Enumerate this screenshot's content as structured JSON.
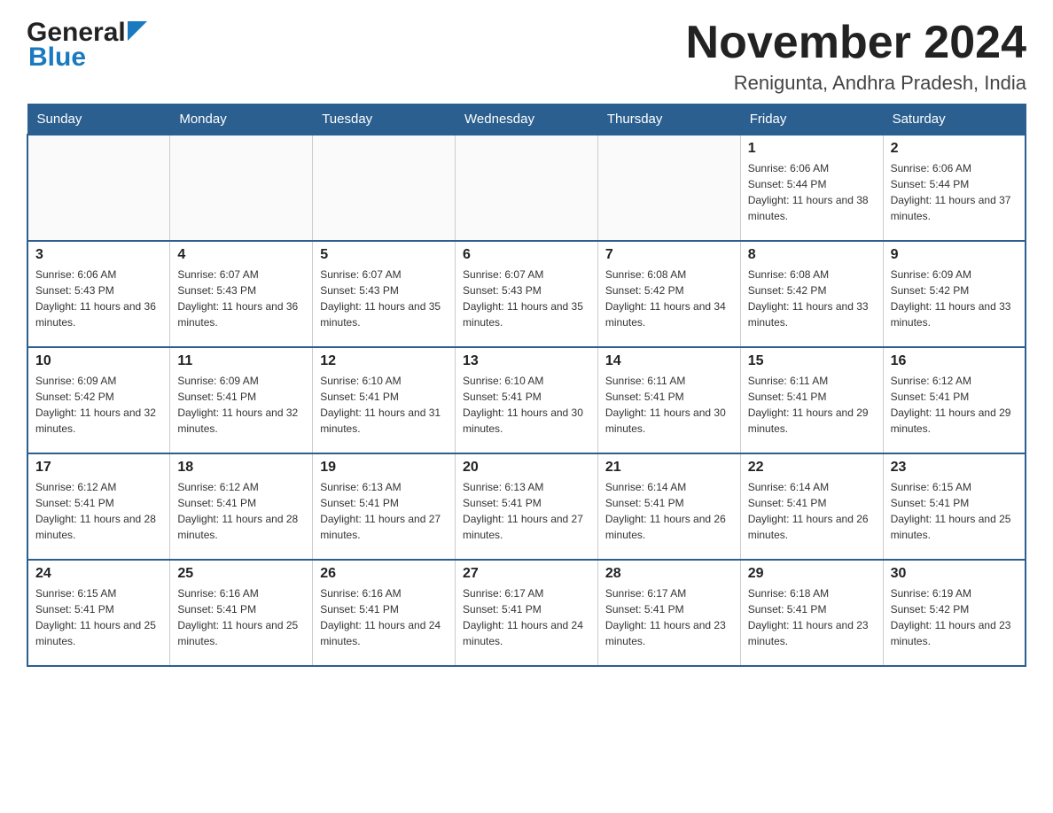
{
  "header": {
    "logo_general": "General",
    "logo_blue": "Blue",
    "month_title": "November 2024",
    "location": "Renigunta, Andhra Pradesh, India"
  },
  "days_of_week": [
    "Sunday",
    "Monday",
    "Tuesday",
    "Wednesday",
    "Thursday",
    "Friday",
    "Saturday"
  ],
  "weeks": [
    [
      {
        "day": "",
        "info": ""
      },
      {
        "day": "",
        "info": ""
      },
      {
        "day": "",
        "info": ""
      },
      {
        "day": "",
        "info": ""
      },
      {
        "day": "",
        "info": ""
      },
      {
        "day": "1",
        "info": "Sunrise: 6:06 AM\nSunset: 5:44 PM\nDaylight: 11 hours and 38 minutes."
      },
      {
        "day": "2",
        "info": "Sunrise: 6:06 AM\nSunset: 5:44 PM\nDaylight: 11 hours and 37 minutes."
      }
    ],
    [
      {
        "day": "3",
        "info": "Sunrise: 6:06 AM\nSunset: 5:43 PM\nDaylight: 11 hours and 36 minutes."
      },
      {
        "day": "4",
        "info": "Sunrise: 6:07 AM\nSunset: 5:43 PM\nDaylight: 11 hours and 36 minutes."
      },
      {
        "day": "5",
        "info": "Sunrise: 6:07 AM\nSunset: 5:43 PM\nDaylight: 11 hours and 35 minutes."
      },
      {
        "day": "6",
        "info": "Sunrise: 6:07 AM\nSunset: 5:43 PM\nDaylight: 11 hours and 35 minutes."
      },
      {
        "day": "7",
        "info": "Sunrise: 6:08 AM\nSunset: 5:42 PM\nDaylight: 11 hours and 34 minutes."
      },
      {
        "day": "8",
        "info": "Sunrise: 6:08 AM\nSunset: 5:42 PM\nDaylight: 11 hours and 33 minutes."
      },
      {
        "day": "9",
        "info": "Sunrise: 6:09 AM\nSunset: 5:42 PM\nDaylight: 11 hours and 33 minutes."
      }
    ],
    [
      {
        "day": "10",
        "info": "Sunrise: 6:09 AM\nSunset: 5:42 PM\nDaylight: 11 hours and 32 minutes."
      },
      {
        "day": "11",
        "info": "Sunrise: 6:09 AM\nSunset: 5:41 PM\nDaylight: 11 hours and 32 minutes."
      },
      {
        "day": "12",
        "info": "Sunrise: 6:10 AM\nSunset: 5:41 PM\nDaylight: 11 hours and 31 minutes."
      },
      {
        "day": "13",
        "info": "Sunrise: 6:10 AM\nSunset: 5:41 PM\nDaylight: 11 hours and 30 minutes."
      },
      {
        "day": "14",
        "info": "Sunrise: 6:11 AM\nSunset: 5:41 PM\nDaylight: 11 hours and 30 minutes."
      },
      {
        "day": "15",
        "info": "Sunrise: 6:11 AM\nSunset: 5:41 PM\nDaylight: 11 hours and 29 minutes."
      },
      {
        "day": "16",
        "info": "Sunrise: 6:12 AM\nSunset: 5:41 PM\nDaylight: 11 hours and 29 minutes."
      }
    ],
    [
      {
        "day": "17",
        "info": "Sunrise: 6:12 AM\nSunset: 5:41 PM\nDaylight: 11 hours and 28 minutes."
      },
      {
        "day": "18",
        "info": "Sunrise: 6:12 AM\nSunset: 5:41 PM\nDaylight: 11 hours and 28 minutes."
      },
      {
        "day": "19",
        "info": "Sunrise: 6:13 AM\nSunset: 5:41 PM\nDaylight: 11 hours and 27 minutes."
      },
      {
        "day": "20",
        "info": "Sunrise: 6:13 AM\nSunset: 5:41 PM\nDaylight: 11 hours and 27 minutes."
      },
      {
        "day": "21",
        "info": "Sunrise: 6:14 AM\nSunset: 5:41 PM\nDaylight: 11 hours and 26 minutes."
      },
      {
        "day": "22",
        "info": "Sunrise: 6:14 AM\nSunset: 5:41 PM\nDaylight: 11 hours and 26 minutes."
      },
      {
        "day": "23",
        "info": "Sunrise: 6:15 AM\nSunset: 5:41 PM\nDaylight: 11 hours and 25 minutes."
      }
    ],
    [
      {
        "day": "24",
        "info": "Sunrise: 6:15 AM\nSunset: 5:41 PM\nDaylight: 11 hours and 25 minutes."
      },
      {
        "day": "25",
        "info": "Sunrise: 6:16 AM\nSunset: 5:41 PM\nDaylight: 11 hours and 25 minutes."
      },
      {
        "day": "26",
        "info": "Sunrise: 6:16 AM\nSunset: 5:41 PM\nDaylight: 11 hours and 24 minutes."
      },
      {
        "day": "27",
        "info": "Sunrise: 6:17 AM\nSunset: 5:41 PM\nDaylight: 11 hours and 24 minutes."
      },
      {
        "day": "28",
        "info": "Sunrise: 6:17 AM\nSunset: 5:41 PM\nDaylight: 11 hours and 23 minutes."
      },
      {
        "day": "29",
        "info": "Sunrise: 6:18 AM\nSunset: 5:41 PM\nDaylight: 11 hours and 23 minutes."
      },
      {
        "day": "30",
        "info": "Sunrise: 6:19 AM\nSunset: 5:42 PM\nDaylight: 11 hours and 23 minutes."
      }
    ]
  ]
}
